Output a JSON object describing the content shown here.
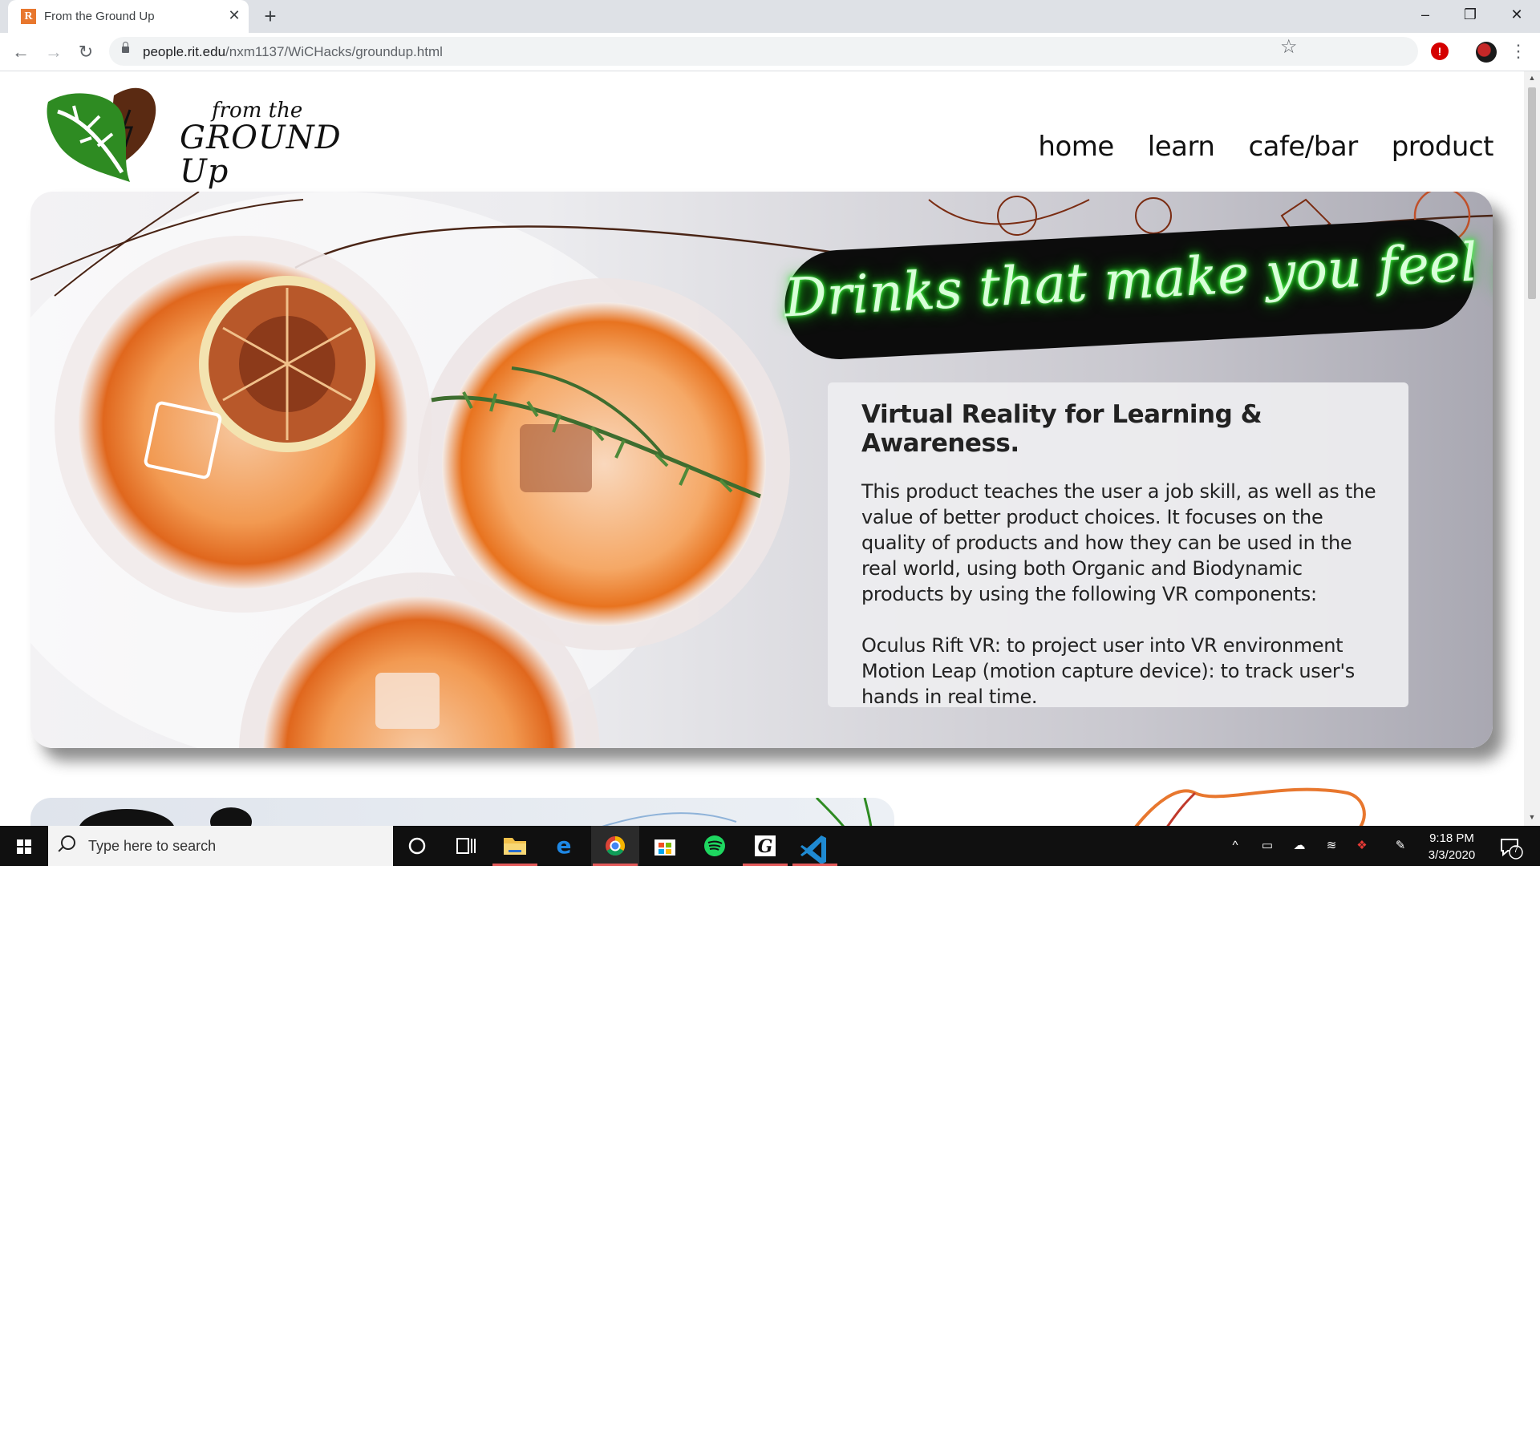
{
  "browser": {
    "tab_title": "From the Ground Up",
    "tab_favicon": "R",
    "url_host": "people.rit.edu",
    "url_path": "/nxm1137/WiCHacks/groundup.html"
  },
  "site": {
    "logo_small": "from the",
    "logo_big": "GROUND Up",
    "nav": [
      "home",
      "learn",
      "cafe/bar",
      "product"
    ]
  },
  "hero": {
    "neon_text": "Drinks that make you feel good!",
    "card_title": "Virtual Reality for Learning & Awareness.",
    "card_paragraph": "This product teaches the user a job skill, as well as the value of better product choices. It focuses on the quality of products and how they can be used in the real world, using both Organic and Biodynamic products by using the following VR components:",
    "card_components": [
      "Oculus Rift VR: to project user into VR environment",
      "Motion Leap (motion capture device): to track user's hands in real time."
    ]
  },
  "taskbar": {
    "search_placeholder": "Type here to search",
    "apps": [
      "cortana-icon",
      "task-view-icon",
      "file-explorer-icon",
      "edge-icon",
      "chrome-icon",
      "store-icon",
      "spotify-icon",
      "grammarly-icon",
      "vscode-icon"
    ],
    "time": "9:18 PM",
    "date": "3/3/2020",
    "notification_count": "7"
  },
  "colors": {
    "accent_orange": "#e8772e",
    "neon_green": "#19e619",
    "taskbar": "#101010"
  }
}
